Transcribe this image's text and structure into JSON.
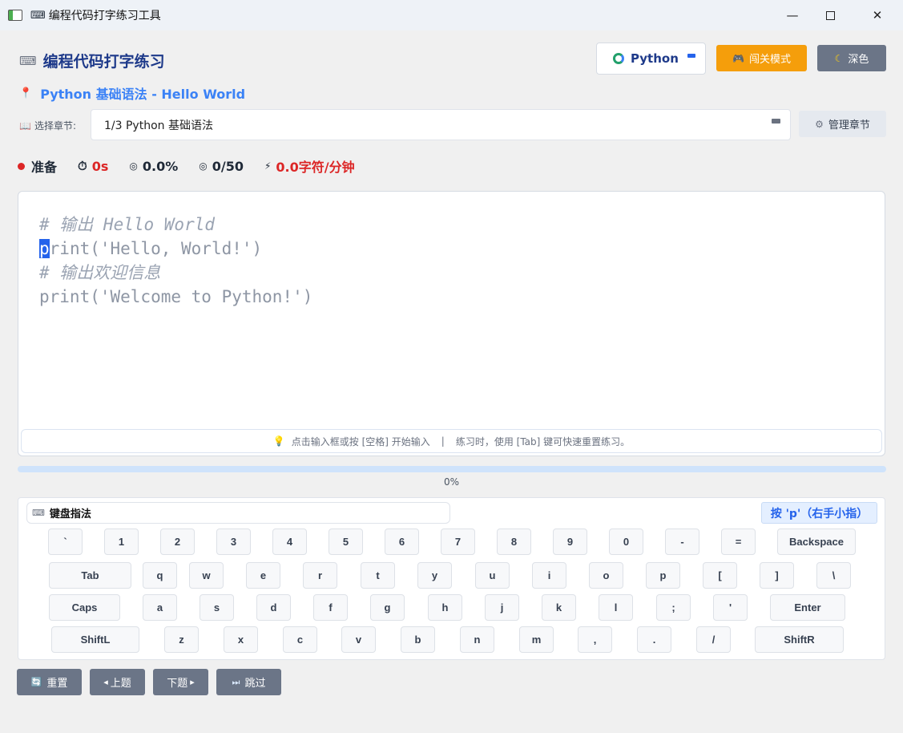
{
  "window": {
    "title": "编程代码打字练习工具",
    "minimize_glyph": "—",
    "close_glyph": "✕"
  },
  "header": {
    "app_title": "编程代码打字练习",
    "app_icon": "keyboard-icon",
    "language_button": "Python",
    "level_mode_button": "闯关模式",
    "dark_mode_button": "深色"
  },
  "lesson": {
    "title": "Python 基础语法 - Hello World"
  },
  "chapter": {
    "label": "选择章节:",
    "selected": "1/3 Python 基础语法",
    "manage_button": "管理章节"
  },
  "stats": {
    "status": "准备",
    "time": "0s",
    "accuracy": "0.0%",
    "progress_count": "0/50",
    "speed": "0.0字符/分钟"
  },
  "editor": {
    "lines": [
      {
        "text": "# 输出 Hello World",
        "type": "comment"
      },
      {
        "text": "print('Hello, World!')",
        "type": "code",
        "cursor": 0
      },
      {
        "text": "# 输出欢迎信息",
        "type": "comment"
      },
      {
        "text": "print('Welcome to Python!')",
        "type": "code"
      }
    ],
    "hint_left": "点击输入框或按 [空格] 开始输入",
    "hint_separator": "|",
    "hint_right": "练习时，使用 [Tab] 键可快速重置练习。"
  },
  "progress": {
    "percent": 0,
    "label": "0%"
  },
  "keyboard": {
    "title": "键盘指法",
    "finger_hint": "按 'p'（右手小指）",
    "rows": [
      [
        "`",
        "1",
        "2",
        "3",
        "4",
        "5",
        "6",
        "7",
        "8",
        "9",
        "0",
        "-",
        "=",
        "Backspace"
      ],
      [
        "Tab",
        "q",
        "w",
        "e",
        "r",
        "t",
        "y",
        "u",
        "i",
        "o",
        "p",
        "[",
        "]",
        "\\"
      ],
      [
        "Caps",
        "a",
        "s",
        "d",
        "f",
        "g",
        "h",
        "j",
        "k",
        "l",
        ";",
        "'",
        "Enter"
      ],
      [
        "ShiftL",
        "z",
        "x",
        "c",
        "v",
        "b",
        "n",
        "m",
        ",",
        ".",
        "/",
        "ShiftR"
      ]
    ]
  },
  "actions": {
    "reset": "重置",
    "prev": "上题",
    "next": "下题",
    "skip": "跳过"
  },
  "colors": {
    "accent": "#3b82f6",
    "title_blue": "#1e3a8a",
    "level_orange": "#f59e0b",
    "button_gray": "#6b7587",
    "status_red": "#dc2626"
  }
}
